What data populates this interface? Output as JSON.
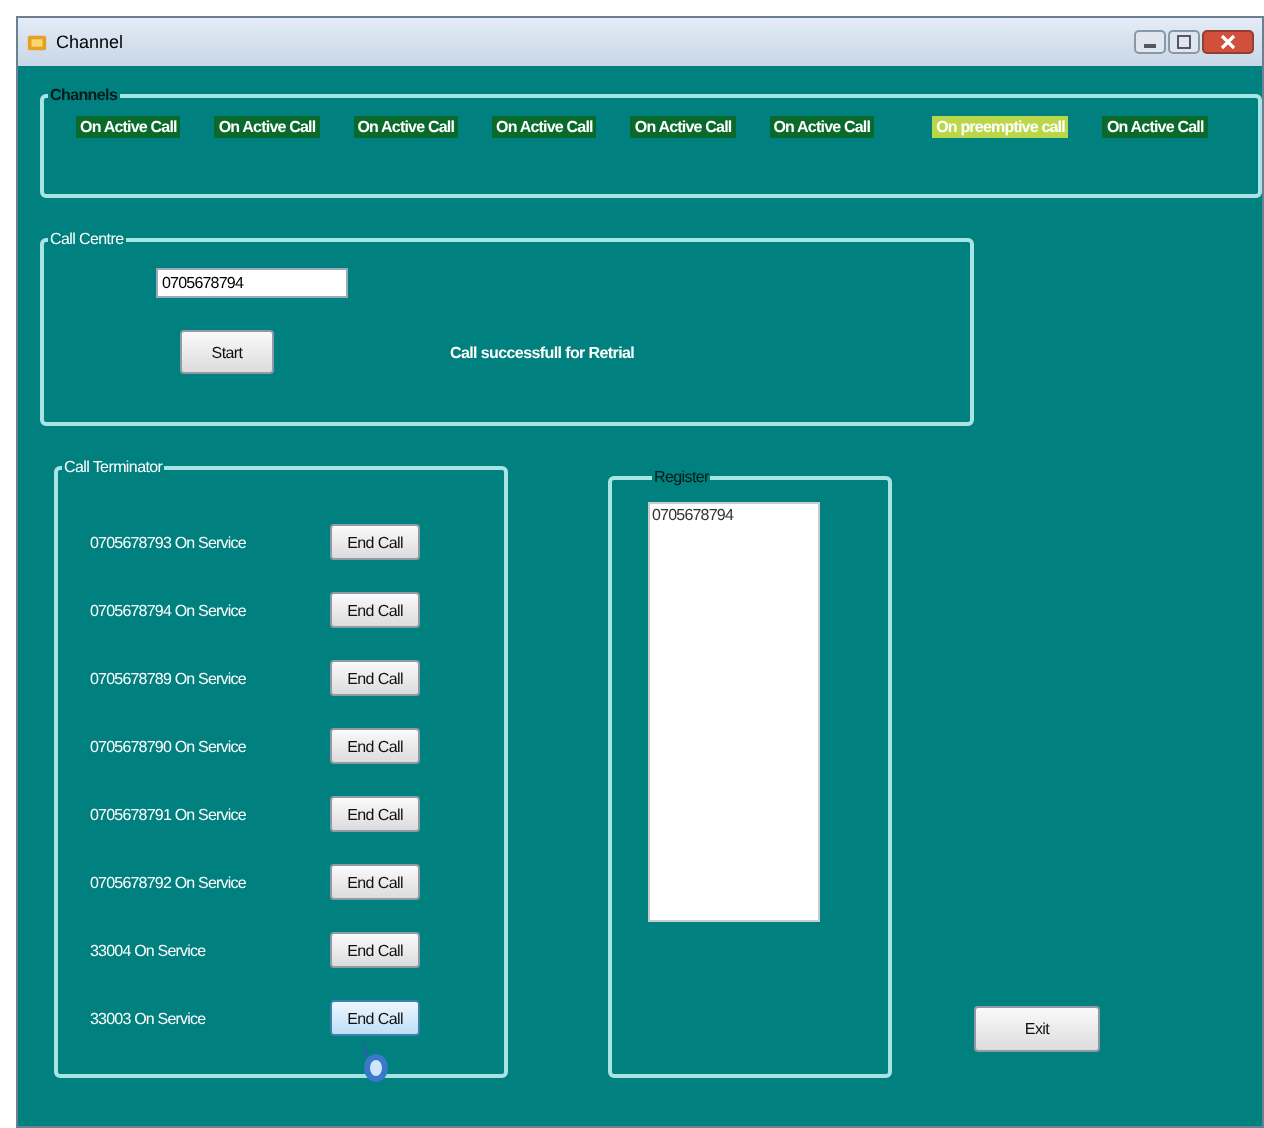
{
  "window": {
    "title": "Channel"
  },
  "channels": {
    "title": "Channels",
    "items": [
      {
        "label": "On Active Call",
        "kind": "active"
      },
      {
        "label": "On Active Call",
        "kind": "active"
      },
      {
        "label": "On Active Call",
        "kind": "active"
      },
      {
        "label": "On Active Call",
        "kind": "active"
      },
      {
        "label": "On Active Call",
        "kind": "active"
      },
      {
        "label": "On Active Call",
        "kind": "active"
      },
      {
        "label": "On preemptive call",
        "kind": "preemptive"
      },
      {
        "label": "On Active Call",
        "kind": "active"
      }
    ]
  },
  "call_centre": {
    "title": "Call Centre",
    "number": "0705678794",
    "start_button": "Start",
    "message": "Call successfull for Retrial"
  },
  "call_terminator": {
    "title": "Call Terminator",
    "rows": [
      {
        "label": "0705678793 On Service",
        "button": "End Call",
        "hovered": false
      },
      {
        "label": "0705678794 On Service",
        "button": "End Call",
        "hovered": false
      },
      {
        "label": "0705678789 On Service",
        "button": "End Call",
        "hovered": false
      },
      {
        "label": "0705678790 On Service",
        "button": "End Call",
        "hovered": false
      },
      {
        "label": "0705678791 On Service",
        "button": "End Call",
        "hovered": false
      },
      {
        "label": "0705678792 On Service",
        "button": "End Call",
        "hovered": false
      },
      {
        "label": "33004 On Service",
        "button": "End Call",
        "hovered": false
      },
      {
        "label": "33003 On Service",
        "button": "End Call",
        "hovered": true
      }
    ]
  },
  "register": {
    "title": "Register",
    "entries": [
      "0705678794"
    ]
  },
  "exit_button": "Exit"
}
